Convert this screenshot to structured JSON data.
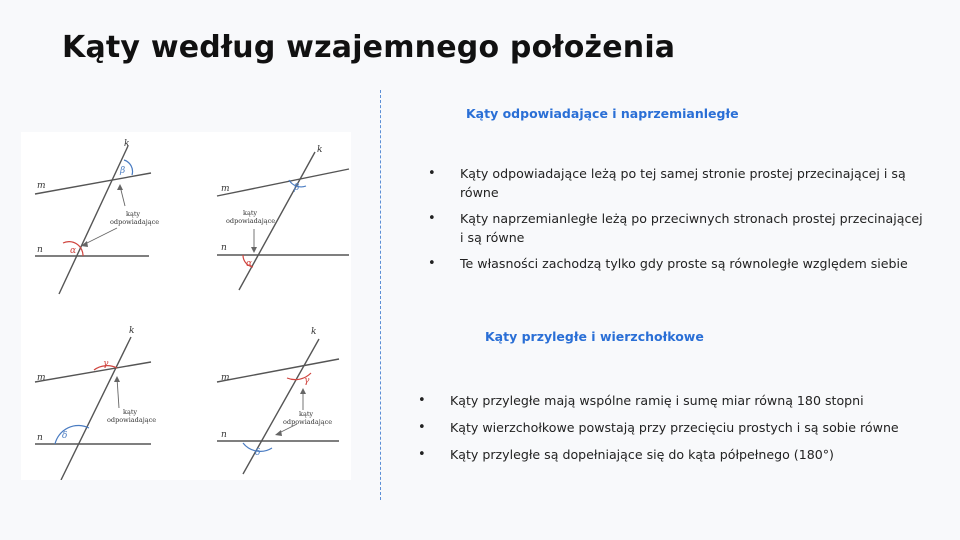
{
  "slide": {
    "title": "Kąty według wzajemnego położenia"
  },
  "section1": {
    "heading": "Kąty odpowiadające i naprzemianległe",
    "bullets": [
      "Kąty odpowiadające leżą po tej samej stronie prostej przecinającej i są równe",
      "Kąty naprzemianległe leżą po przeciwnych stronach prostej przecinającej i są równe",
      "Te własności zachodzą tylko gdy proste są równoległe względem siebie"
    ]
  },
  "section2": {
    "heading": "Kąty przyległe i wierzchołkowe",
    "bullets": [
      "Kąty przyległe mają wspólne ramię i sumę miar równą 180 stopni",
      "Kąty wierzchołkowe powstają przy przecięciu prostych i są sobie równe",
      "Kąty przyległe są dopełniające się do kąta półpełnego (180°)"
    ]
  },
  "figure": {
    "line_k": "k",
    "line_m": "m",
    "line_n": "n",
    "greek": {
      "alpha": "α",
      "beta": "β",
      "gamma": "γ",
      "delta": "δ"
    },
    "caption_line1": "kąty",
    "caption_line2": "odpowiadające",
    "colors": {
      "red": "#d0453f",
      "blue": "#4a7cc2",
      "line": "#555555"
    }
  }
}
